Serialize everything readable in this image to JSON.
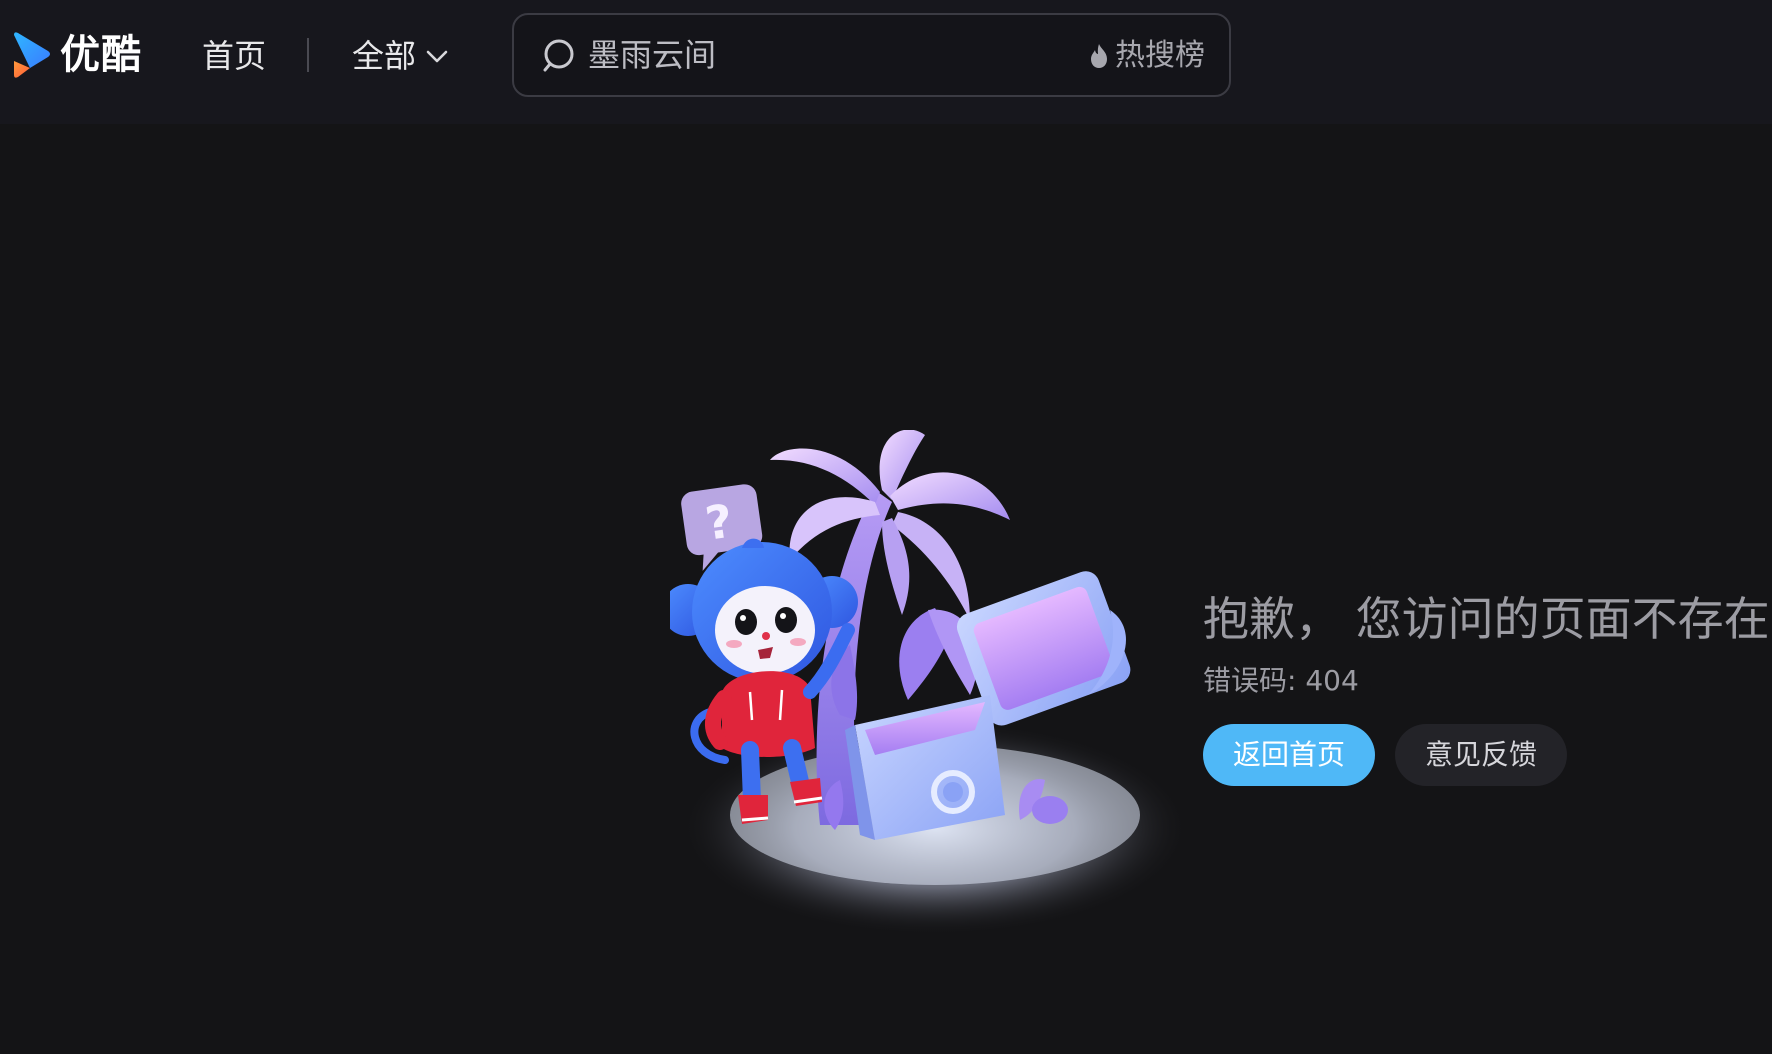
{
  "header": {
    "logo_text": "优酷",
    "nav_home_label": "首页",
    "nav_all_label": "全部",
    "search": {
      "placeholder": "墨雨云间",
      "hot_label": "热搜榜"
    }
  },
  "error": {
    "title": "抱歉， 您访问的页面不存在",
    "code_text": "错误码: 404",
    "home_button_label": "返回首页",
    "feedback_button_label": "意见反馈"
  },
  "illustration": {
    "question_mark": "?"
  },
  "icons": {
    "logo": "youku-play-logo-icon",
    "chevron": "chevron-down-icon",
    "search": "search-icon",
    "hot": "flame-icon"
  },
  "colors": {
    "background": "#141416",
    "header_background": "#17171d",
    "primary_button": "#4fb8f7",
    "secondary_button": "#232328",
    "muted_text": "#9c9ca3"
  }
}
